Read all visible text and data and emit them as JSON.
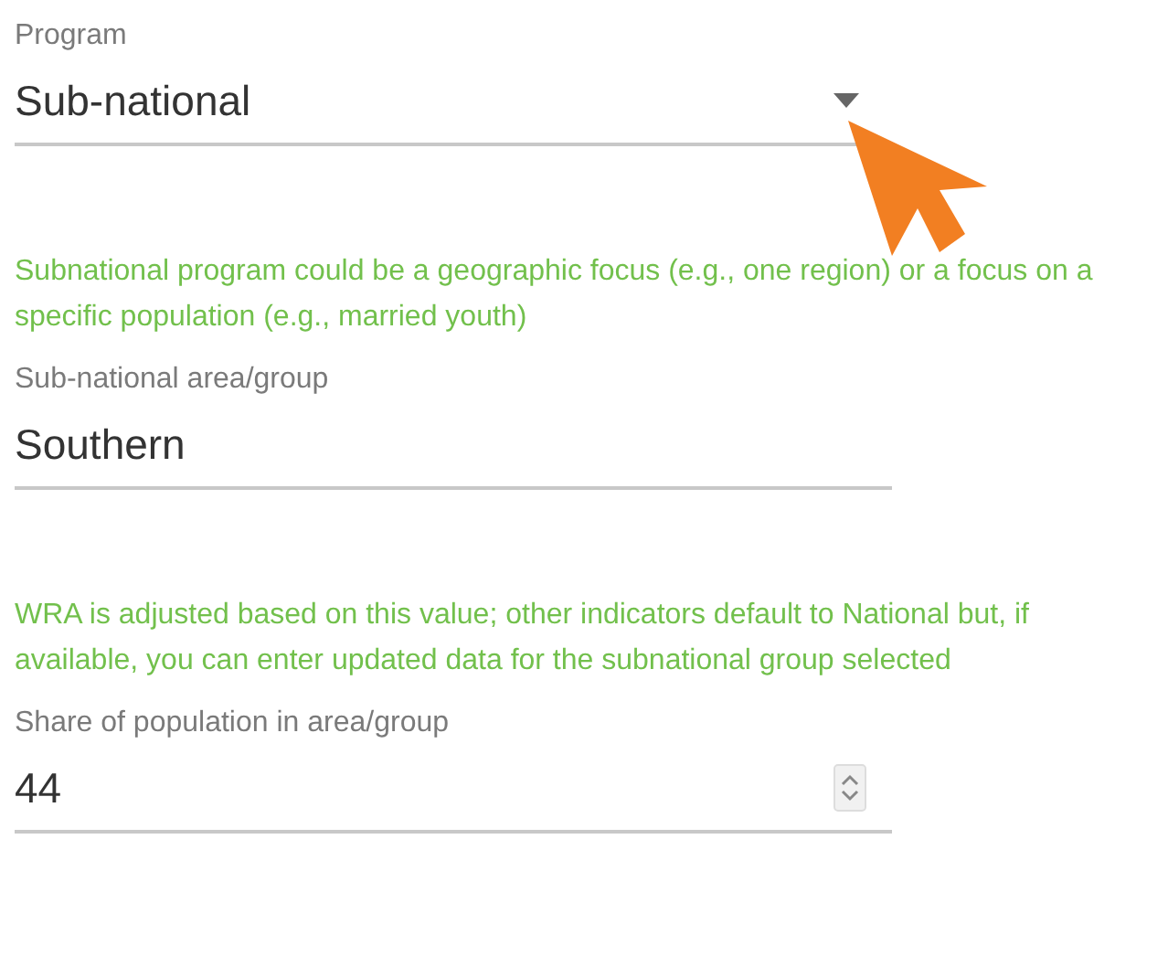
{
  "fields": [
    {
      "kind": "select",
      "label": "Program",
      "value": "Sub-national",
      "help": "Subnational program could be a geographic focus (e.g., one region) or a focus on a specific population (e.g., married youth)"
    },
    {
      "kind": "text",
      "label": "Sub-national area/group",
      "value": "Southern",
      "help": "WRA is adjusted based on this value; other indicators default to National but, if available, you can enter updated data for the subnational group selected"
    },
    {
      "kind": "number",
      "label": "Share of population in area/group",
      "value": "44"
    }
  ]
}
